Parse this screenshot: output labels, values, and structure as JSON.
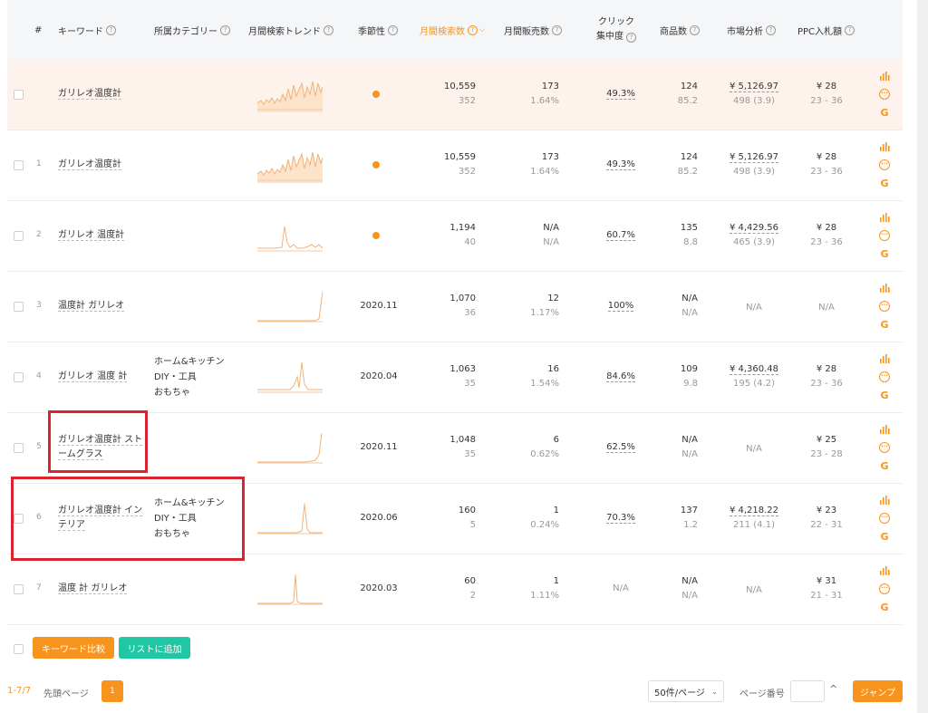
{
  "header": {
    "hash": "#",
    "keyword": "キーワード",
    "category": "所属カテゴリー",
    "trend": "月間検索トレンド",
    "season": "季節性",
    "monthly_search": "月間検索数",
    "monthly_sales": "月間販売数",
    "click_line1": "クリック",
    "click_line2": "集中度",
    "products": "商品数",
    "market": "市場分析",
    "ppc": "PPC入札額"
  },
  "rows": [
    {
      "index": "",
      "keyword": "ガリレオ温度計",
      "category": [],
      "season": "",
      "seasonal_dot": true,
      "search": "10,559",
      "search_sub": "352",
      "sales": "173",
      "sales_sub": "1.64%",
      "click": "49.3%",
      "products": "124",
      "products_sub": "85.2",
      "market": "¥ 5,126.97",
      "market_sub": "498 (3.9)",
      "ppc": "¥ 28",
      "ppc_sub": "23 - 36",
      "highlighted": true
    },
    {
      "index": "1",
      "keyword": "ガリレオ温度計",
      "category": [],
      "season": "",
      "seasonal_dot": true,
      "search": "10,559",
      "search_sub": "352",
      "sales": "173",
      "sales_sub": "1.64%",
      "click": "49.3%",
      "products": "124",
      "products_sub": "85.2",
      "market": "¥ 5,126.97",
      "market_sub": "498 (3.9)",
      "ppc": "¥ 28",
      "ppc_sub": "23 - 36"
    },
    {
      "index": "2",
      "keyword": "ガリレオ 温度計",
      "category": [],
      "season": "",
      "seasonal_dot": true,
      "search": "1,194",
      "search_sub": "40",
      "sales": "N/A",
      "sales_sub": "N/A",
      "click": "60.7%",
      "products": "135",
      "products_sub": "8.8",
      "market": "¥ 4,429.56",
      "market_sub": "465 (3.9)",
      "ppc": "¥ 28",
      "ppc_sub": "23 - 36"
    },
    {
      "index": "3",
      "keyword": "温度計 ガリレオ",
      "category": [],
      "season": "2020.11",
      "seasonal_dot": false,
      "search": "1,070",
      "search_sub": "36",
      "sales": "12",
      "sales_sub": "1.17%",
      "click": "100%",
      "products": "N/A",
      "products_sub": "N/A",
      "market": "N/A",
      "market_sub": "",
      "ppc": "N/A",
      "ppc_sub": ""
    },
    {
      "index": "4",
      "keyword": "ガリレオ 温度 計",
      "category": [
        "ホーム&キッチン",
        "DIY・工具",
        "おもちゃ"
      ],
      "season": "2020.04",
      "seasonal_dot": false,
      "search": "1,063",
      "search_sub": "35",
      "sales": "16",
      "sales_sub": "1.54%",
      "click": "84.6%",
      "products": "109",
      "products_sub": "9.8",
      "market": "¥ 4,360.48",
      "market_sub": "195 (4.2)",
      "ppc": "¥ 28",
      "ppc_sub": "23 - 36"
    },
    {
      "index": "5",
      "keyword": "ガリレオ温度計 ストームグラス",
      "category": [],
      "season": "2020.11",
      "seasonal_dot": false,
      "search": "1,048",
      "search_sub": "35",
      "sales": "6",
      "sales_sub": "0.62%",
      "click": "62.5%",
      "products": "N/A",
      "products_sub": "N/A",
      "market": "N/A",
      "market_sub": "",
      "ppc": "¥ 25",
      "ppc_sub": "23 - 28"
    },
    {
      "index": "6",
      "keyword": "ガリレオ温度計 インテリア",
      "category": [
        "ホーム&キッチン",
        "DIY・工具",
        "おもちゃ"
      ],
      "season": "2020.06",
      "seasonal_dot": false,
      "search": "160",
      "search_sub": "5",
      "sales": "1",
      "sales_sub": "0.24%",
      "click": "70.3%",
      "products": "137",
      "products_sub": "1.2",
      "market": "¥ 4,218.22",
      "market_sub": "211 (4.1)",
      "ppc": "¥ 23",
      "ppc_sub": "22 - 31"
    },
    {
      "index": "7",
      "keyword": "温度 計 ガリレオ",
      "category": [],
      "season": "2020.03",
      "seasonal_dot": false,
      "search": "60",
      "search_sub": "2",
      "sales": "1",
      "sales_sub": "1.11%",
      "click": "N/A",
      "products": "N/A",
      "products_sub": "N/A",
      "market": "N/A",
      "market_sub": "",
      "ppc": "¥ 31",
      "ppc_sub": "21 - 31"
    }
  ],
  "footer": {
    "compare_button": "キーワード比較",
    "add_list_button": "リストに追加",
    "range": "1-7/7",
    "first_page": "先頭ページ",
    "current_page": "1",
    "per_page": "50件/ページ",
    "page_number_label": "ページ番号",
    "jump_button": "ジャンプ"
  },
  "icons": {
    "chart": "bar-chart-icon",
    "more": "more-dots-icon",
    "google": "G"
  },
  "colors": {
    "accent": "#f7941d",
    "teal": "#1fc7a5",
    "highlight": "#fdf3ec",
    "annotation": "#d9252f"
  }
}
